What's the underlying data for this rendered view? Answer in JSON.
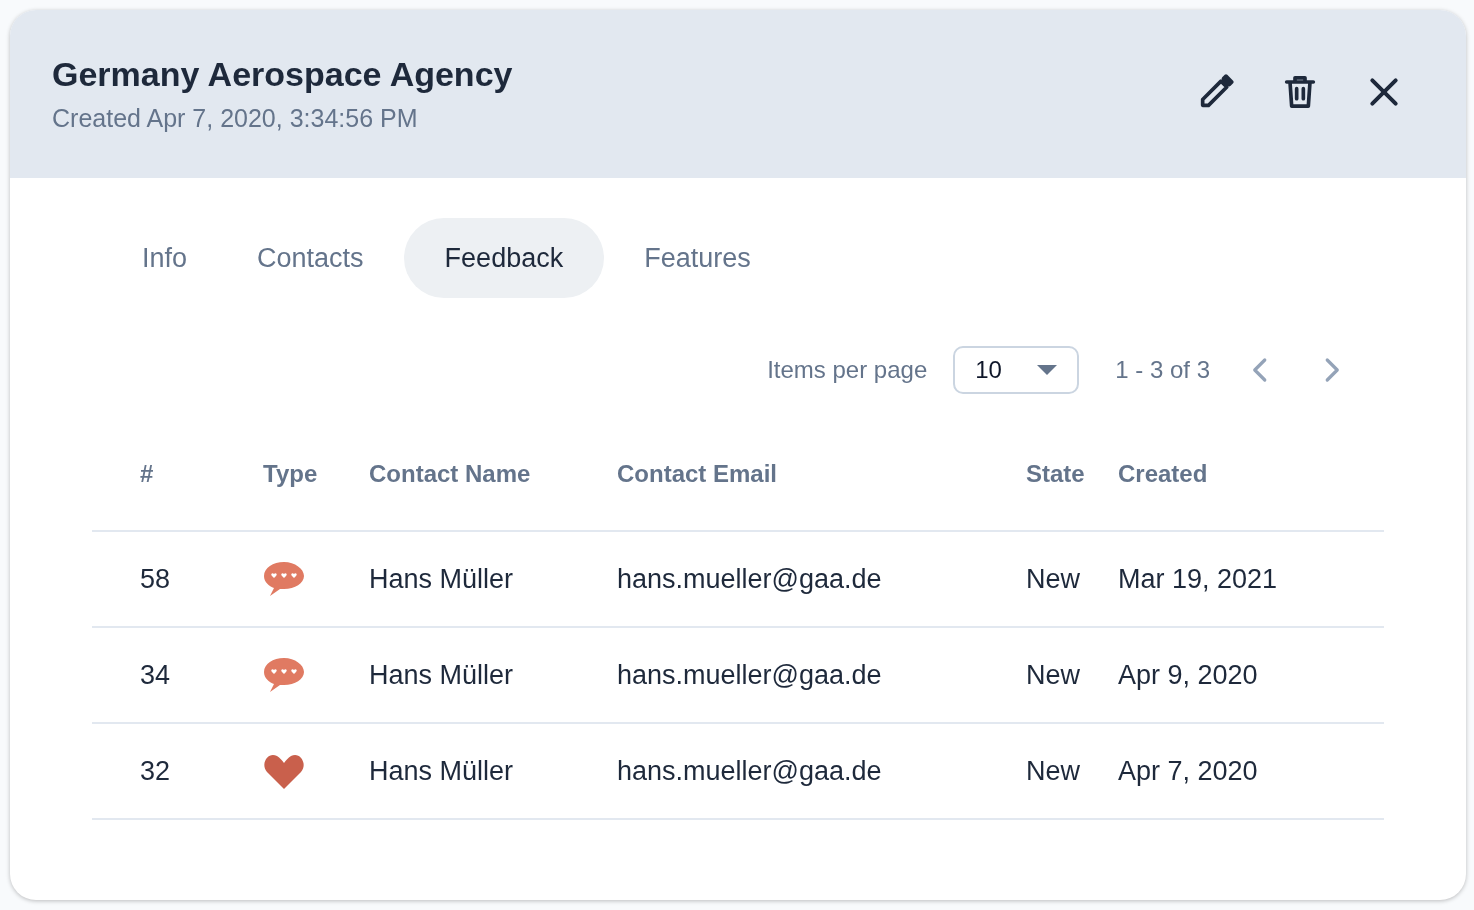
{
  "header": {
    "title": "Germany Aerospace Agency",
    "subtitle": "Created Apr 7, 2020, 3:34:56 PM"
  },
  "tabs": [
    {
      "label": "Info",
      "selected": false
    },
    {
      "label": "Contacts",
      "selected": false
    },
    {
      "label": "Feedback",
      "selected": true
    },
    {
      "label": "Features",
      "selected": false
    }
  ],
  "pagination": {
    "label": "Items per page",
    "page_size": "10",
    "range": "1 - 3 of 3"
  },
  "table": {
    "columns": [
      "#",
      "Type",
      "Contact Name",
      "Contact Email",
      "State",
      "Created"
    ],
    "rows": [
      {
        "id": "58",
        "kind": "comment",
        "name": "Hans Müller",
        "email": "hans.mueller@gaa.de",
        "state": "New",
        "created": "Mar 19, 2021"
      },
      {
        "id": "34",
        "kind": "comment",
        "name": "Hans Müller",
        "email": "hans.mueller@gaa.de",
        "state": "New",
        "created": "Apr 9, 2020"
      },
      {
        "id": "32",
        "kind": "heart",
        "name": "Hans Müller",
        "email": "hans.mueller@gaa.de",
        "state": "New",
        "created": "Apr 7, 2020"
      }
    ]
  }
}
